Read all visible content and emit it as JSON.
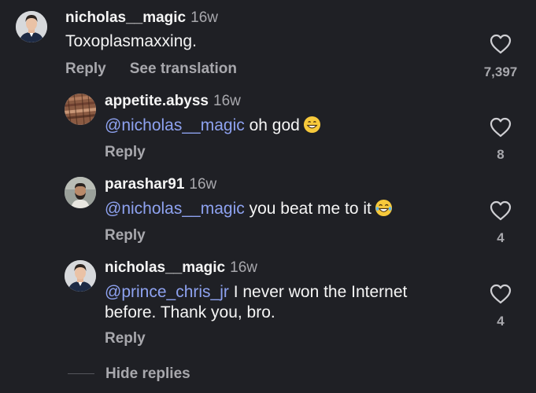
{
  "comments": [
    {
      "username": "nicholas__magic",
      "time": "16w",
      "mention": "",
      "text": "Toxoplasmaxxing.",
      "reply_label": "Reply",
      "translate_label": "See translation",
      "likes": "7,397",
      "avatar": "person-in-suit-avatar"
    },
    {
      "username": "appetite.abyss",
      "time": "16w",
      "mention": "@nicholas__magic",
      "text": " oh god",
      "emoji": "grinning-face-emoji",
      "reply_label": "Reply",
      "likes": "8",
      "avatar": "wood-texture-avatar"
    },
    {
      "username": "parashar91",
      "time": "16w",
      "mention": "@nicholas__magic",
      "text": " you beat me to it",
      "emoji": "tears-of-joy-emoji",
      "reply_label": "Reply",
      "likes": "4",
      "avatar": "bearded-man-avatar"
    },
    {
      "username": "nicholas__magic",
      "time": "16w",
      "mention": "@prince_chris_jr",
      "text": " I never won the Internet before. Thank you, bro.",
      "reply_label": "Reply",
      "likes": "4",
      "avatar": "person-in-suit-avatar"
    }
  ],
  "hide_replies_label": "Hide replies",
  "colors": {
    "background": "#1f2025",
    "mention": "#8ea2f0",
    "muted": "#a8a8ad",
    "text": "#f5f5f5"
  }
}
